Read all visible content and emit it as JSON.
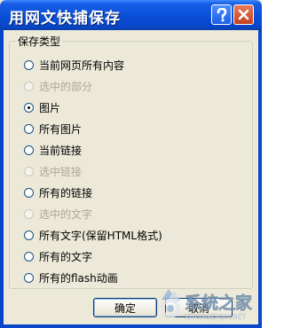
{
  "window": {
    "title": "用网文快捕保存"
  },
  "titlebar_buttons": {
    "help_icon": "help-icon",
    "close_icon": "close-icon"
  },
  "group": {
    "label": "保存类型"
  },
  "options": [
    {
      "label": "当前网页所有内容",
      "enabled": true,
      "selected": false
    },
    {
      "label": "选中的部分",
      "enabled": false,
      "selected": false
    },
    {
      "label": "图片",
      "enabled": true,
      "selected": true
    },
    {
      "label": "所有图片",
      "enabled": true,
      "selected": false
    },
    {
      "label": "当前链接",
      "enabled": true,
      "selected": false
    },
    {
      "label": "选中链接",
      "enabled": false,
      "selected": false
    },
    {
      "label": "所有的链接",
      "enabled": true,
      "selected": false
    },
    {
      "label": "选中的文字",
      "enabled": false,
      "selected": false
    },
    {
      "label": "所有文字(保留HTML格式)",
      "enabled": true,
      "selected": false
    },
    {
      "label": "所有的文字",
      "enabled": true,
      "selected": false
    },
    {
      "label": "所有的flash动画",
      "enabled": true,
      "selected": false
    }
  ],
  "buttons": {
    "ok": "确定",
    "cancel": "取消"
  },
  "watermark": {
    "text": "系统之家",
    "url_text": "XITONGZHIJIA.NET"
  },
  "colors": {
    "titlebar": "#0a50d8",
    "face": "#ece9d8",
    "disabled_text": "#aca899"
  }
}
